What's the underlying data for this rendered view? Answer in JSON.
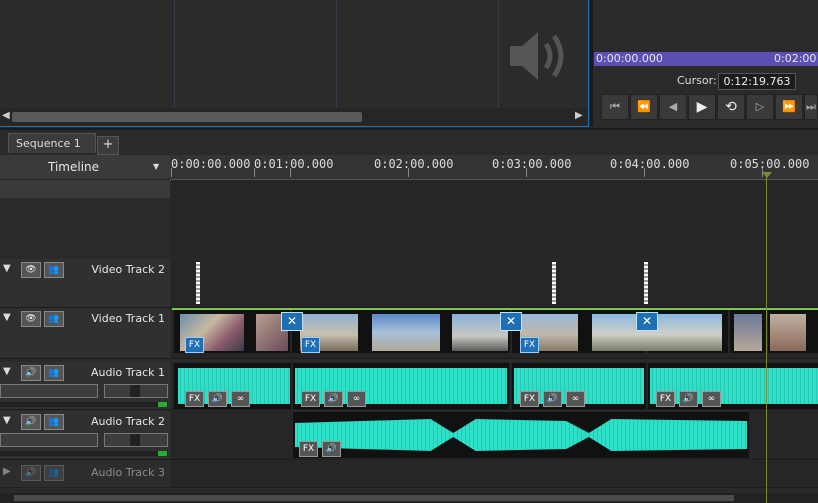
{
  "preview": {
    "start_time": "0:00:00.000",
    "end_time": "0:02:00",
    "cursor_label": "Cursor:",
    "cursor_value": "0:12:19.763"
  },
  "tabs": [
    {
      "label": "Sequence 1",
      "close": "✕"
    },
    {
      "label": "+"
    }
  ],
  "timeline": {
    "header_label": "Timeline",
    "ruler": [
      "0:00:00.000",
      "0:01:00.000",
      "0:02:00.000",
      "0:03:00.000",
      "0:04:00.000",
      "0:05:00.000"
    ]
  },
  "tracks": [
    {
      "name": "Video Track 2",
      "type": "video"
    },
    {
      "name": "Video Track 1",
      "type": "video"
    },
    {
      "name": "Audio Track 1",
      "type": "audio"
    },
    {
      "name": "Audio Track 2",
      "type": "audio"
    },
    {
      "name": "Audio Track 3",
      "type": "audio",
      "disabled": true
    }
  ],
  "clip_labels": {
    "fx": "FX"
  },
  "colors": {
    "accent": "#1e6fb0",
    "wave": "#2fe0c8",
    "timebar": "#5b4fb3",
    "meter": "#2aa83a"
  }
}
